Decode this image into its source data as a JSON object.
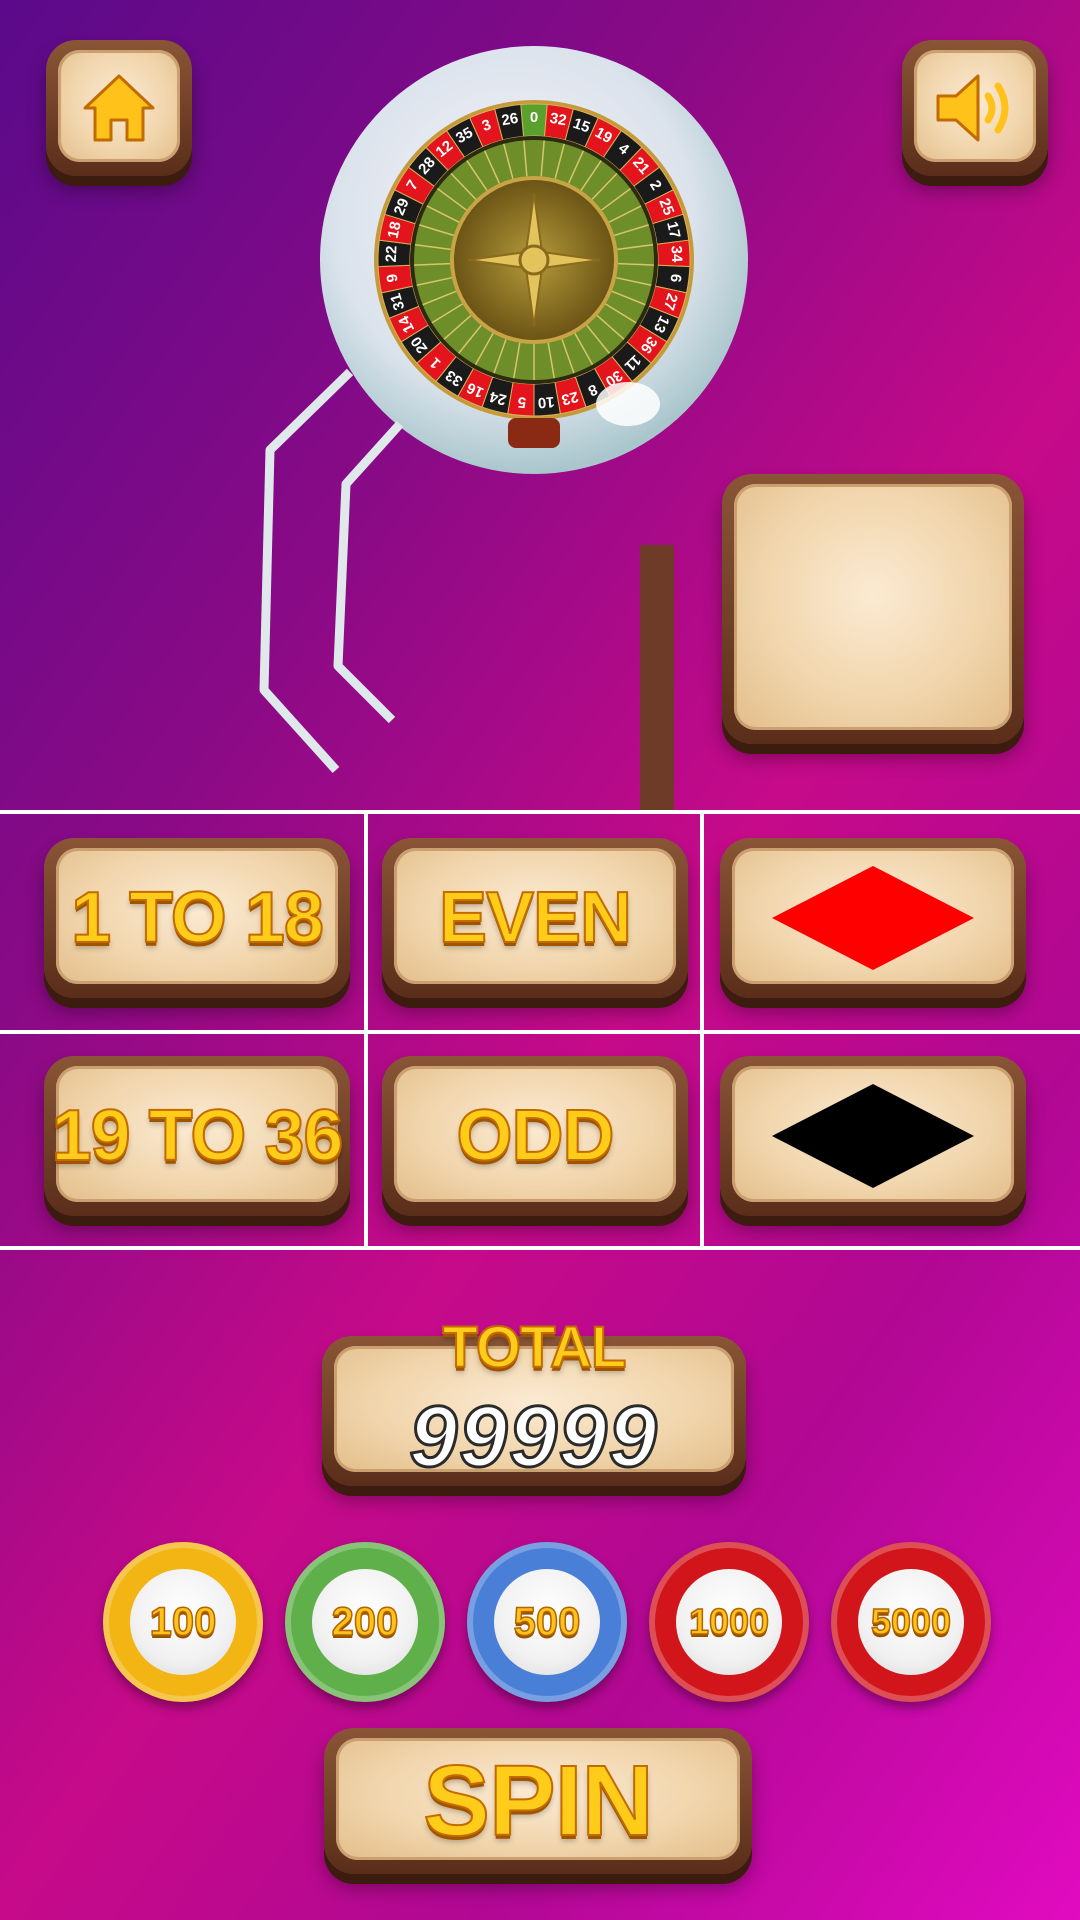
{
  "buttons": {
    "home_icon": "home-icon",
    "sound_icon": "speaker-icon"
  },
  "wheel": {
    "numbers": [
      "0",
      "32",
      "15",
      "19",
      "4",
      "21",
      "2",
      "25",
      "17",
      "34",
      "6",
      "27",
      "13",
      "36",
      "11",
      "30",
      "8",
      "23",
      "10",
      "5",
      "24",
      "16",
      "33",
      "1",
      "20",
      "14",
      "31",
      "9",
      "22",
      "18",
      "29",
      "7",
      "28",
      "12",
      "35",
      "3",
      "26"
    ],
    "colors": {
      "red": "#e3141b",
      "black": "#1a1a1a",
      "green": "#5aa02c"
    }
  },
  "bets": [
    {
      "label": "1 TO 18"
    },
    {
      "label": "EVEN"
    },
    {
      "label": "RED",
      "color": "#ff0000"
    },
    {
      "label": "19 TO 36"
    },
    {
      "label": "ODD"
    },
    {
      "label": "BLACK",
      "color": "#000000"
    }
  ],
  "total": {
    "label": "TOTAL",
    "value": "99999"
  },
  "chips": [
    {
      "value": "100",
      "color": "#f3b514"
    },
    {
      "value": "200",
      "color": "#5fb04a"
    },
    {
      "value": "500",
      "color": "#4a7fd8"
    },
    {
      "value": "1000",
      "color": "#d2141b"
    },
    {
      "value": "5000",
      "color": "#d2141b"
    }
  ],
  "spin": {
    "label": "SPIN"
  }
}
